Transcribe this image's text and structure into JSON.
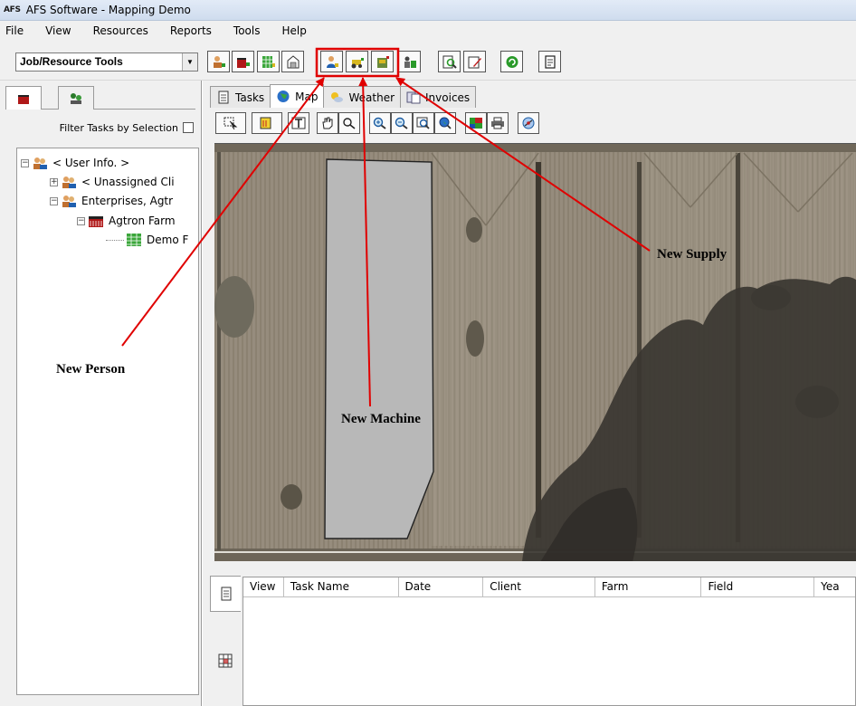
{
  "window": {
    "app_badge": "AFS",
    "title": "AFS Software - Mapping Demo"
  },
  "menu": [
    "File",
    "View",
    "Resources",
    "Reports",
    "Tools",
    "Help"
  ],
  "toolbar": {
    "combo_value": "Job/Resource Tools",
    "buttons": [
      {
        "icon": "new-client-icon"
      },
      {
        "icon": "new-farm-icon"
      },
      {
        "icon": "new-field-icon"
      },
      {
        "icon": "new-storage-icon"
      },
      {
        "icon": "new-person-icon"
      },
      {
        "icon": "new-machine-icon"
      },
      {
        "icon": "new-supply-icon"
      },
      {
        "icon": "new-resource-icon"
      },
      {
        "icon": "magnify-icon"
      },
      {
        "icon": "edit-icon"
      },
      {
        "icon": "refresh-icon"
      },
      {
        "icon": "document-icon"
      }
    ]
  },
  "left_panel": {
    "filter_label": "Filter Tasks by Selection",
    "tree": [
      {
        "label": "< User Info. >",
        "level": 0,
        "expander": "−",
        "icon": "person-group-icon"
      },
      {
        "label": "< Unassigned Cli",
        "level": 1,
        "expander": "+",
        "icon": "person-group-icon"
      },
      {
        "label": "Enterprises, Agtr",
        "level": 1,
        "expander": "−",
        "icon": "person-group-icon"
      },
      {
        "label": "Agtron Farm",
        "level": 2,
        "expander": "−",
        "icon": "farm-icon"
      },
      {
        "label": "Demo F",
        "level": 3,
        "expander": "",
        "icon": "field-icon"
      }
    ]
  },
  "tabs": [
    {
      "label": "Tasks",
      "icon": "tasks-icon",
      "active": false
    },
    {
      "label": "Map",
      "icon": "globe-icon",
      "active": true
    },
    {
      "label": "Weather",
      "icon": "weather-icon",
      "active": false
    },
    {
      "label": "Invoices",
      "icon": "invoices-icon",
      "active": false
    }
  ],
  "grid": {
    "columns": [
      "View",
      "Task Name",
      "Date",
      "Client",
      "Farm",
      "Field",
      "Yea"
    ]
  },
  "annotations": {
    "new_person": "New Person",
    "new_machine": "New Machine",
    "new_supply": "New Supply"
  },
  "colors": {
    "highlight_red": "#e00000",
    "field_polygon": "#b8b8b8"
  }
}
